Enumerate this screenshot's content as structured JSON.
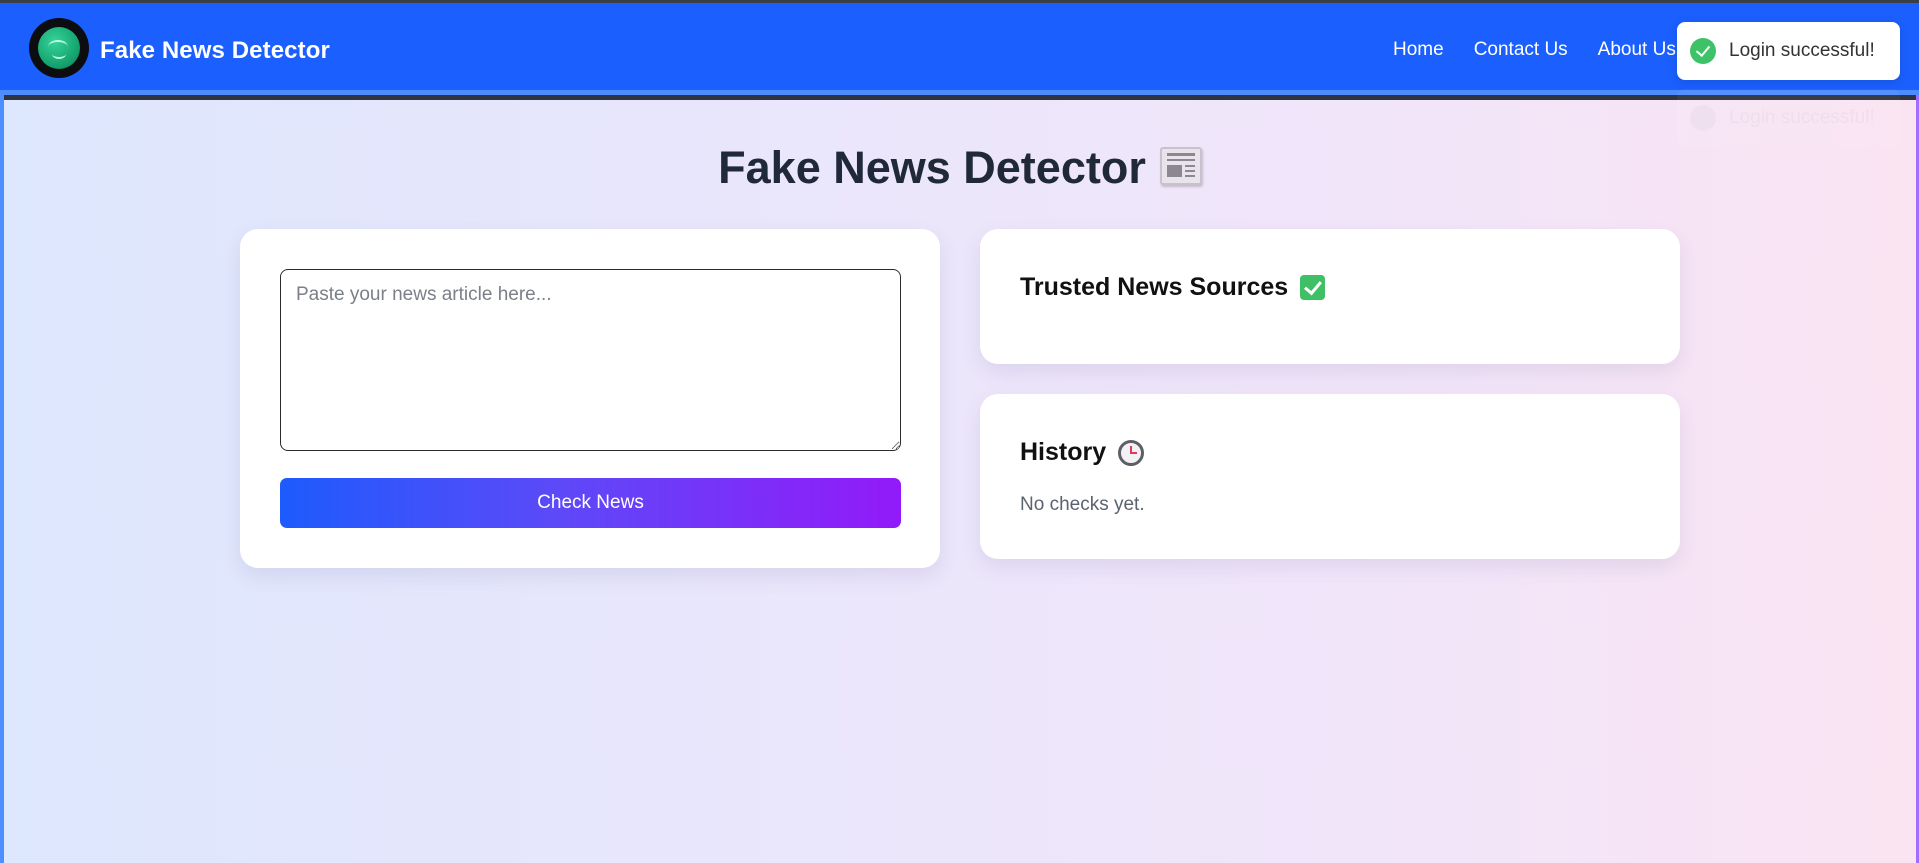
{
  "navbar": {
    "brand": "Fake News Detector",
    "links": [
      "Home",
      "Contact Us",
      "About Us"
    ]
  },
  "toast": {
    "message": "Login successful!",
    "ghost_message": "Login successful!"
  },
  "main": {
    "title": "Fake News Detector",
    "title_icon": "newspaper-icon",
    "input": {
      "placeholder": "Paste your news article here...",
      "value": ""
    },
    "check_button_label": "Check News",
    "trusted": {
      "title": "Trusted News Sources",
      "icon": "check-box-icon"
    },
    "history": {
      "title": "History",
      "icon": "clock-icon",
      "empty_text": "No checks yet."
    }
  },
  "colors": {
    "navbar": "#1b5ffe",
    "button_start": "#1d5bfd",
    "button_end": "#931af9",
    "success": "#3ec267"
  }
}
